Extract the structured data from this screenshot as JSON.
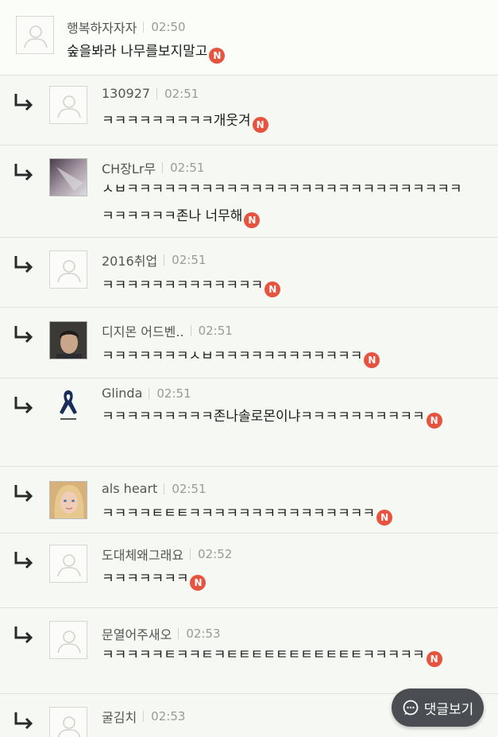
{
  "comments": [
    {
      "nick": "행복하자자자",
      "time": "02:50",
      "text": "숲을봐라 나무를보지말고",
      "avatar": "default",
      "reply": false
    },
    {
      "nick": "130927",
      "time": "02:51",
      "text": "ㅋㅋㅋㅋㅋㅋㅋㅋㅋ개웃겨",
      "avatar": "default",
      "reply": true
    },
    {
      "nick": "CH장Lr무",
      "time": "02:51",
      "text": "ㅅㅂㅋㅋㅋㅋㅋㅋㅋㅋㅋㅋㅋㅋㅋㅋㅋㅋㅋㅋㅋㅋㅋㅋㅋㅋㅋㅋㅋㅋㅋㅋㅋㅋㅋ존나 너무해",
      "avatar": "photo-dark",
      "reply": true
    },
    {
      "nick": "2016취업",
      "time": "02:51",
      "text": "ㅋㅋㅋㅋㅋㅋㅋㅋㅋㅋㅋㅋㅋ",
      "avatar": "default",
      "reply": true
    },
    {
      "nick": "디지몬 어드벤..",
      "time": "02:51",
      "text": "ㅋㅋㅋㅋㅋㅋㅋㅅㅂㅋㅋㅋㅋㅋㅋㅋㅋㅋㅋㅋㅋ",
      "avatar": "photo-man",
      "reply": true
    },
    {
      "nick": "Glinda",
      "time": "02:51",
      "text": "ㅋㅋㅋㅋㅋㅋㅋㅋㅋ존나솔로몬이냐ㅋㅋㅋㅋㅋㅋㅋㅋㅋㅋ",
      "avatar": "ribbon",
      "reply": true
    },
    {
      "nick": "als heart",
      "time": "02:51",
      "text": "ㅋㅋㅋㅋㅌㅌㅌㅋㅋㅋㅋㅋㅋㅋㅋㅋㅋㅋㅋㅋㅋㅋ",
      "avatar": "photo-blonde",
      "reply": true
    },
    {
      "nick": "도대체왜그래요",
      "time": "02:52",
      "text": "ㅋㅋㅋㅋㅋㅋㅋ",
      "avatar": "default",
      "reply": true
    },
    {
      "nick": "문열어주새오",
      "time": "02:53",
      "text": "ㅋㅋㅋㅋㅋㅌㅋㅋㅌㅋㅌㅌㅌㅌㅌㅌㅌㅌㅌㅌㅌㅋㅋㅋㅋㅋ",
      "avatar": "default",
      "reply": true
    },
    {
      "nick": "굴김치",
      "time": "02:53",
      "text": "",
      "avatar": "default",
      "reply": true
    }
  ],
  "new_badge": "N",
  "view_comments_button": {
    "label": "댓글보기",
    "icon": "chat-bubble-icon"
  },
  "colors": {
    "badge": "#e6533f",
    "background": "#f6f8f3",
    "button": "#4a4d52"
  }
}
